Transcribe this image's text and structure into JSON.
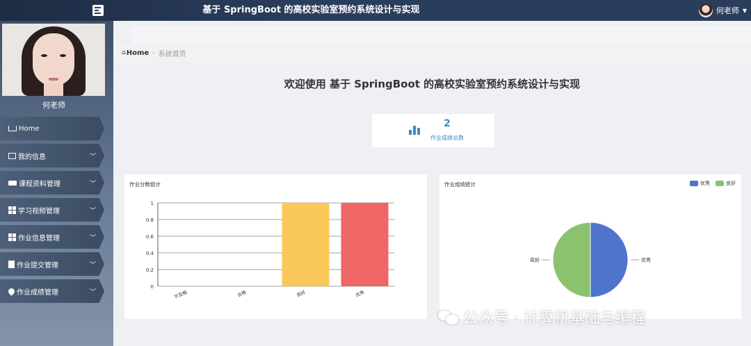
{
  "header": {
    "title": "基于 SpringBoot 的高校实验室预约系统设计与实现",
    "username": "何老师"
  },
  "sidebar": {
    "username": "何老师",
    "items": [
      {
        "label": "Home"
      },
      {
        "label": "我的信息"
      },
      {
        "label": "课程资料管理"
      },
      {
        "label": "学习视频管理"
      },
      {
        "label": "作业信息管理"
      },
      {
        "label": "作业提交管理"
      },
      {
        "label": "作业成绩管理"
      }
    ]
  },
  "breadcrumb": {
    "home": "Home",
    "separator": "-",
    "current": "系统首页"
  },
  "welcome": "欢迎使用 基于 SpringBoot 的高校实验室预约系统设计与实现",
  "stat": {
    "value": "2",
    "label": "作业成绩总数",
    "color": "#3a8ec4"
  },
  "charts": {
    "bar_title": "作业分数统计",
    "pie_title": "作业成绩统计"
  },
  "chart_data": [
    {
      "type": "bar",
      "title": "作业分数统计",
      "categories": [
        "不及格",
        "合格",
        "良好",
        "优秀"
      ],
      "values": [
        0,
        0,
        1,
        1
      ],
      "colors": [
        "#5470c6",
        "#91cc75",
        "#fac858",
        "#ee6666"
      ],
      "yticks": [
        "0",
        "0.2",
        "0.4",
        "0.6",
        "0.8",
        "1"
      ],
      "ylim": [
        0,
        1
      ],
      "grid": true
    },
    {
      "type": "pie",
      "title": "作业成绩统计",
      "slices": [
        {
          "label": "优秀",
          "value": 1,
          "color": "#4f74cb"
        },
        {
          "label": "良好",
          "value": 1,
          "color": "#8ac26e"
        }
      ],
      "legend_position": "top-right"
    }
  ],
  "watermark": "公众号 · 计算机基础与编程"
}
